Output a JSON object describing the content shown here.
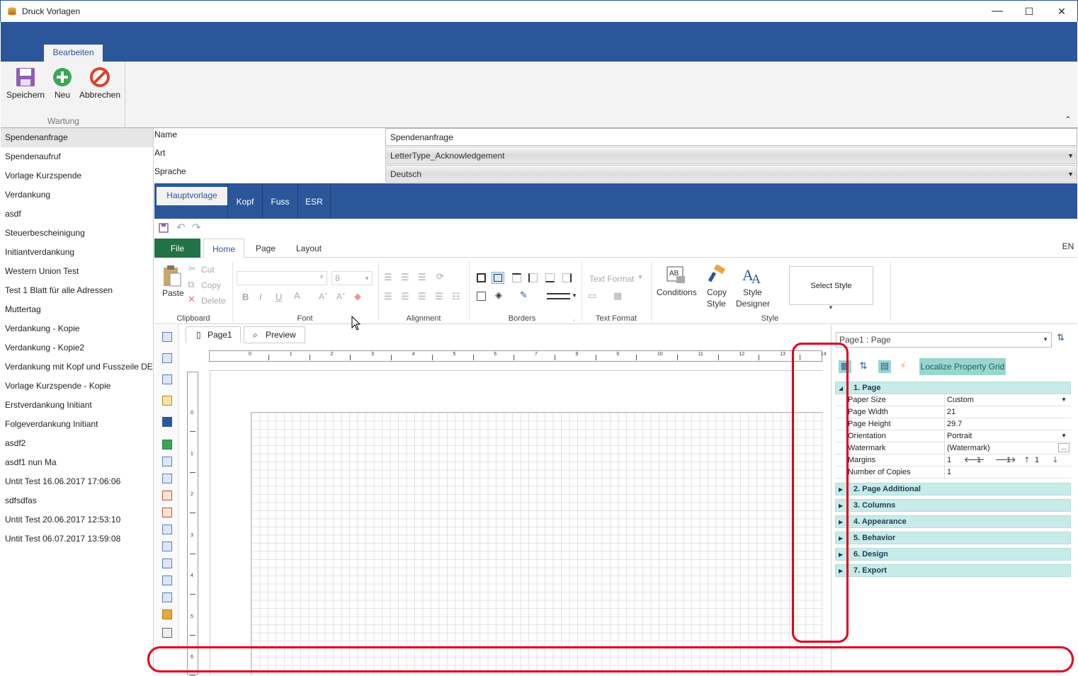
{
  "window": {
    "title": "Druck Vorlagen",
    "minimize": "—",
    "maximize": "☐",
    "close": "✕"
  },
  "ribbon": {
    "tab": "Bearbeiten",
    "buttons": {
      "save": "Speichern",
      "new": "Neu",
      "cancel": "Abbrechen"
    },
    "group": "Wartung",
    "collapse": "⌃"
  },
  "sidebar": {
    "items": [
      "Spendenanfrage",
      "Spendenaufruf",
      "Vorlage Kurzspende",
      "Verdankung",
      "asdf",
      "Steuerbescheinigung",
      "Initiantverdankung",
      "Western Union Test",
      "Test 1 Blatt für alle Adressen",
      "Muttertag",
      "Verdankung - Kopie",
      "Verdankung - Kopie2",
      "Verdankung mit Kopf und Fusszeile DE",
      "Vorlage Kurzspende - Kopie",
      "Erstverdankung Initiant",
      "Folgeverdankung Initiant",
      "asdf2",
      "asdf1 nun Ma",
      "Untit Test 16.06.2017 17:06:06",
      "sdfsdfas",
      "Untit Test 20.06.2017 12:53:10",
      "Untit Test 06.07.2017 13:59:08"
    ]
  },
  "form": {
    "name_label": "Name",
    "name_value": "Spendenanfrage",
    "art_label": "Art",
    "art_value": "LetterType_Acknowledgement",
    "sprache_label": "Sprache",
    "sprache_value": "Deutsch"
  },
  "doctabs": [
    "Hauptvorlage",
    "Kopf",
    "Fuss",
    "ESR"
  ],
  "designer_ribbon": {
    "tabs": {
      "file": "File",
      "home": "Home",
      "page": "Page",
      "layout": "Layout"
    },
    "lang": "EN",
    "clipboard": {
      "paste": "Paste",
      "cut": "Cut",
      "copy": "Copy",
      "delete": "Delete",
      "label": "Clipboard"
    },
    "font": {
      "size": "8",
      "bold": "B",
      "italic": "I",
      "underline": "U",
      "label": "Font"
    },
    "alignment_label": "Alignment",
    "borders_label": "Borders",
    "text_format": {
      "combo": "Text Format",
      "label": "Text Format"
    },
    "style": {
      "conditions": "Conditions",
      "copy_style_1": "Copy",
      "copy_style_2": "Style",
      "style_designer_1": "Style",
      "style_designer_2": "Designer",
      "select_style": "Select Style",
      "label": "Style"
    }
  },
  "page_tabs": {
    "page1": "Page1",
    "preview": "Preview"
  },
  "ruler": {
    "h": [
      "0",
      "1",
      "2",
      "3",
      "4",
      "5",
      "6",
      "7",
      "8",
      "9",
      "10",
      "11",
      "12",
      "13",
      "14"
    ],
    "v": [
      "0",
      "1",
      "2",
      "3",
      "4",
      "5",
      "6"
    ]
  },
  "property_grid": {
    "object": "Page1 : Page",
    "localize": "Localize Property Grid",
    "page_category": "1. Page",
    "rows": [
      {
        "name": "Paper Size",
        "value": "Custom"
      },
      {
        "name": "Page Width",
        "value": "21"
      },
      {
        "name": "Page Height",
        "value": "29.7"
      },
      {
        "name": "Orientation",
        "value": "Portrait"
      },
      {
        "name": "Watermark",
        "value": "(Watermark)"
      },
      {
        "name": "Margins",
        "value": "1"
      },
      {
        "name": "Number of Copies",
        "value": "1"
      }
    ],
    "margins": {
      "left": "1",
      "right": "1",
      "top": "1",
      "bottom": "1"
    },
    "categories": [
      "2. Page  Additional",
      "3. Columns",
      "4. Appearance",
      "5. Behavior",
      "6. Design",
      "7. Export"
    ]
  },
  "colors": {
    "accent": "#2b579a",
    "file_tab": "#217346",
    "grid_category": "#c7ebe6",
    "highlight": "#e0001b"
  }
}
